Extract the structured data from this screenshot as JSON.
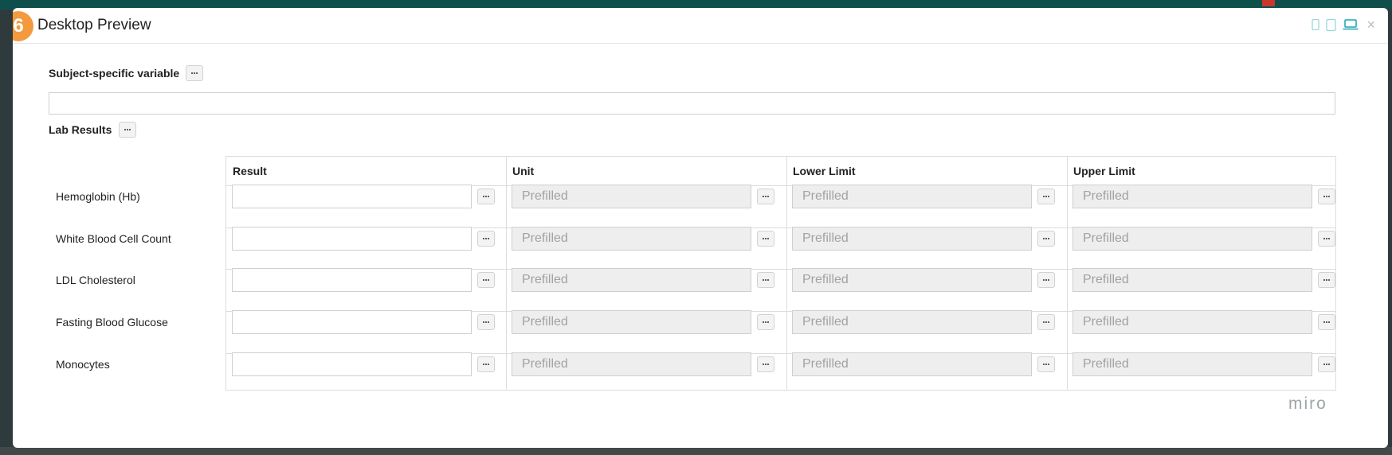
{
  "modal": {
    "step": "6",
    "title": "Desktop Preview",
    "devices": [
      "phone-icon",
      "tablet-icon",
      "laptop-icon"
    ],
    "active_device": "laptop-icon",
    "close_label": "×",
    "accent": "#17a4b5",
    "badge_color": "#f39a3f"
  },
  "subject": {
    "label": "Subject-specific variable",
    "value": ""
  },
  "lab": {
    "label": "Lab Results",
    "columns": [
      "Result",
      "Unit",
      "Lower Limit",
      "Upper Limit"
    ],
    "rows": [
      {
        "label": "Hemoglobin (Hb)",
        "result": "",
        "unit": "Prefilled",
        "lower": "Prefilled",
        "upper": "Prefilled"
      },
      {
        "label": "White Blood Cell Count",
        "result": "",
        "unit": "Prefilled",
        "lower": "Prefilled",
        "upper": "Prefilled"
      },
      {
        "label": "LDL Cholesterol",
        "result": "",
        "unit": "Prefilled",
        "lower": "Prefilled",
        "upper": "Prefilled"
      },
      {
        "label": "Fasting Blood Glucose",
        "result": "",
        "unit": "Prefilled",
        "lower": "Prefilled",
        "upper": "Prefilled"
      },
      {
        "label": "Monocytes",
        "result": "",
        "unit": "Prefilled",
        "lower": "Prefilled",
        "upper": "Prefilled"
      }
    ]
  },
  "watermark": "miro"
}
